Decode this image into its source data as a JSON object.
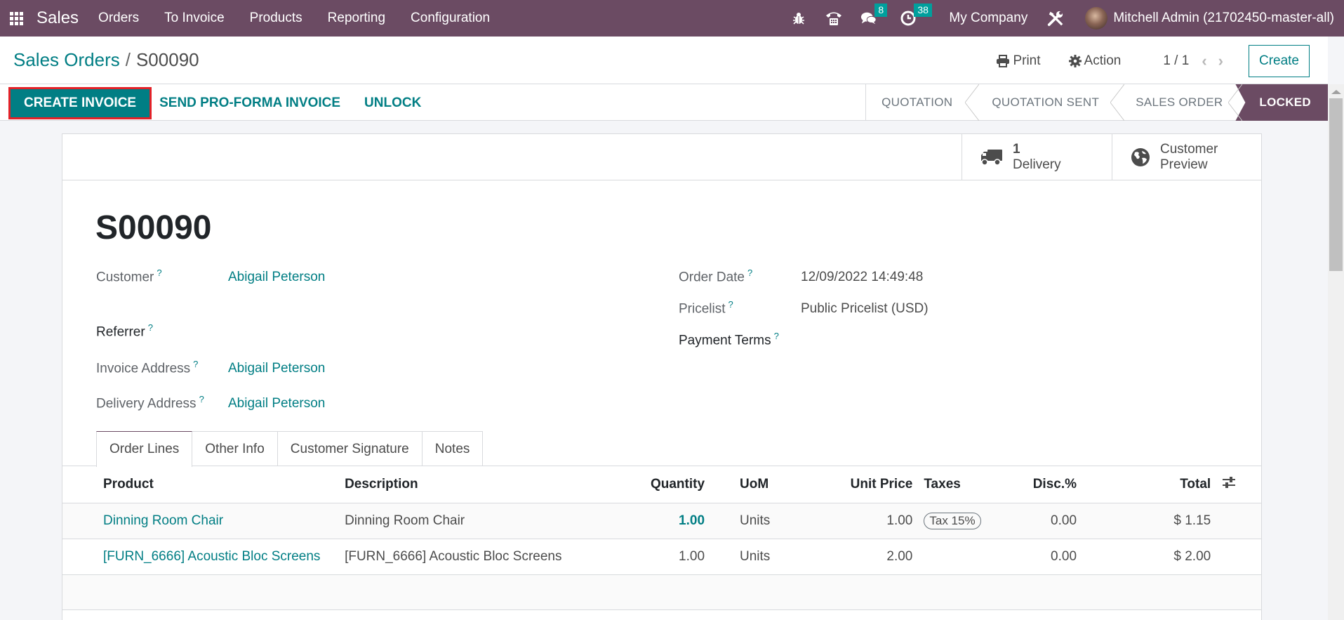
{
  "navbar": {
    "app_name": "Sales",
    "menu": [
      "Orders",
      "To Invoice",
      "Products",
      "Reporting",
      "Configuration"
    ],
    "icons": [
      "bug-icon",
      "phone-icon",
      "chat-icon",
      "clock-icon"
    ],
    "messages_count": "8",
    "activities_count": "38",
    "company": "My Company",
    "user": "Mitchell Admin (21702450-master-all)"
  },
  "control_panel": {
    "breadcrumb_parent": "Sales Orders",
    "breadcrumb_separator": "/",
    "breadcrumb_current": "S00090",
    "print_label": "Print",
    "action_label": "Action",
    "pager": "1 / 1",
    "prev_glyph": "‹",
    "next_glyph": "›",
    "create_label": "Create"
  },
  "statusbar": {
    "buttons": [
      "CREATE INVOICE",
      "SEND PRO-FORMA INVOICE",
      "UNLOCK"
    ],
    "stages": [
      "QUOTATION",
      "QUOTATION SENT",
      "SALES ORDER",
      "LOCKED"
    ],
    "active_stage": "LOCKED"
  },
  "smart_buttons": {
    "delivery_value": "1",
    "delivery_label": "Delivery",
    "preview_line1": "Customer",
    "preview_line2": "Preview"
  },
  "form": {
    "title": "S00090",
    "help_mark": "?",
    "customer_label": "Customer",
    "customer_value": "Abigail Peterson",
    "referrer_label": "Referrer",
    "invoice_address_label": "Invoice Address",
    "invoice_address_value": "Abigail Peterson",
    "delivery_address_label": "Delivery Address",
    "delivery_address_value": "Abigail Peterson",
    "order_date_label": "Order Date",
    "order_date_value": "12/09/2022 14:49:48",
    "pricelist_label": "Pricelist",
    "pricelist_value": "Public Pricelist (USD)",
    "payment_terms_label": "Payment Terms"
  },
  "tabs": [
    "Order Lines",
    "Other Info",
    "Customer Signature",
    "Notes"
  ],
  "active_tab": "Order Lines",
  "order_lines": {
    "columns": [
      "Product",
      "Description",
      "Quantity",
      "UoM",
      "Unit Price",
      "Taxes",
      "Disc.%",
      "Total"
    ],
    "rows": [
      {
        "product": "Dinning Room Chair",
        "description": "Dinning Room Chair",
        "quantity": "1.00",
        "uom": "Units",
        "unit_price": "1.00",
        "taxes": "Tax 15%",
        "discount": "0.00",
        "total": "$ 1.15"
      },
      {
        "product": "[FURN_6666] Acoustic Bloc Screens",
        "description": "[FURN_6666] Acoustic Bloc Screens",
        "quantity": "1.00",
        "uom": "Units",
        "unit_price": "2.00",
        "taxes": "",
        "discount": "0.00",
        "total": "$ 2.00"
      }
    ]
  },
  "colors": {
    "brand": "#6b4b63",
    "primary": "#017e84",
    "highlight_box": "#e22128",
    "badge": "#00a09d"
  }
}
